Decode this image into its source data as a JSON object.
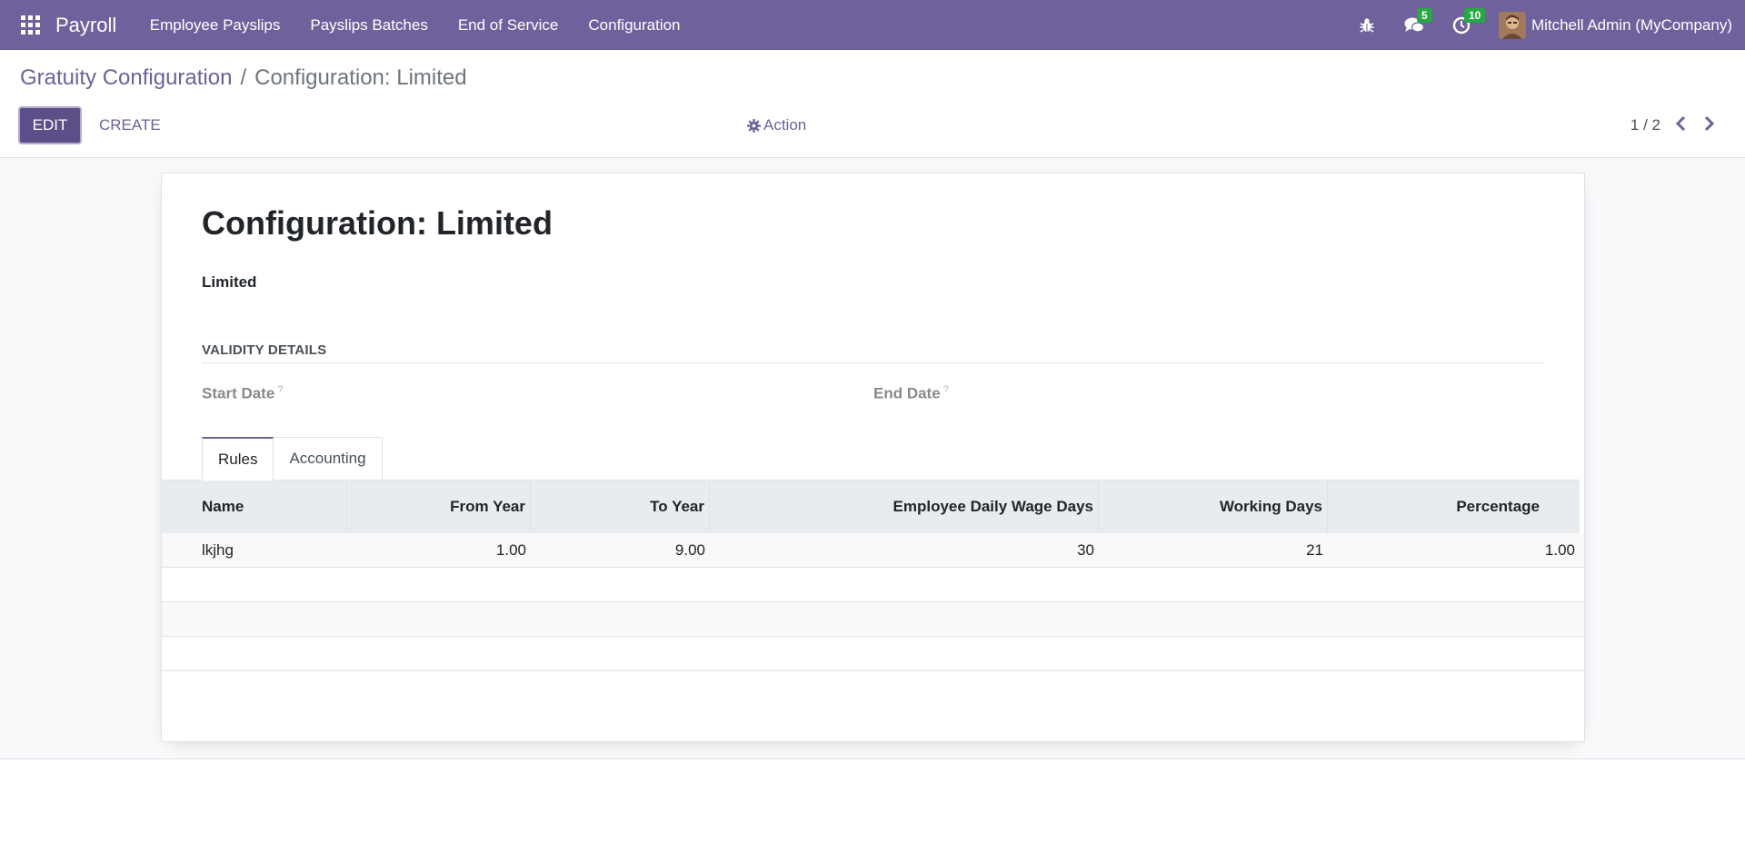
{
  "navbar": {
    "app_name": "Payroll",
    "menu": [
      "Employee Payslips",
      "Payslips Batches",
      "End of Service",
      "Configuration"
    ],
    "messages_count": "5",
    "activities_count": "10",
    "user_name": "Mitchell Admin (MyCompany)",
    "bg_color": "#6f619c"
  },
  "breadcrumb": {
    "parent": "Gratuity Configuration",
    "separator": "/",
    "current": "Configuration: Limited"
  },
  "buttons": {
    "edit": "EDIT",
    "create": "CREATE",
    "action": "Action"
  },
  "pager": {
    "value": "1 / 2"
  },
  "record": {
    "title": "Configuration: Limited",
    "subtitle": "Limited",
    "section": "VALIDITY DETAILS",
    "start_date_label": "Start Date",
    "end_date_label": "End Date",
    "help_mark": "?"
  },
  "tabs": [
    "Rules",
    "Accounting"
  ],
  "table": {
    "columns": [
      "Name",
      "From Year",
      "To Year",
      "Employee Daily Wage Days",
      "Working Days",
      "Percentage"
    ],
    "rows": [
      [
        "lkjhg",
        "1.00",
        "9.00",
        "30",
        "21",
        "1.00"
      ]
    ]
  }
}
